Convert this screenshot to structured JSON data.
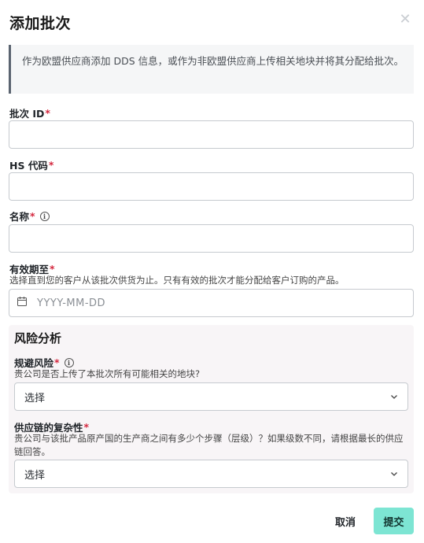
{
  "dialog": {
    "title": "添加批次",
    "close_icon": "close-icon",
    "info_text": "作为欧盟供应商添加 DDS 信息，或作为非欧盟供应商上传相关地块并将其分配给批次。"
  },
  "fields": {
    "batch_id": {
      "label": "批次 ID",
      "required": "*",
      "value": ""
    },
    "hs_code": {
      "label": "HS 代码",
      "required": "*",
      "value": ""
    },
    "name": {
      "label": "名称",
      "required": "*",
      "value": "",
      "info_icon": "info-icon"
    },
    "valid_until": {
      "label": "有效期至",
      "required": "*",
      "hint": "选择直到您的客户从该批次供货为止。只有有效的批次才能分配给客户订购的产品。",
      "placeholder": "YYYY-MM-DD",
      "icon": "calendar-icon"
    }
  },
  "risk_analysis": {
    "title": "风险分析",
    "circumvention": {
      "label": "规避风险",
      "required": "*",
      "info_icon": "info-icon",
      "hint": "贵公司是否上传了本批次所有可能相关的地块?",
      "selected": "选择"
    },
    "complexity": {
      "label": "供应链的复杂性",
      "required": "*",
      "hint_line1": "贵公司与该批产品原产国的生产商之间有多少个步骤（层级）？如果级数不同，请根据最长的供应",
      "hint_line2": "链回答。",
      "selected": "选择"
    }
  },
  "actions": {
    "cancel": "取消",
    "submit": "提交"
  },
  "colors": {
    "required": "#d4273e",
    "submit_bg": "#7de5d3",
    "risk_bg": "#f8f5f7",
    "info_border": "#5b6470"
  }
}
